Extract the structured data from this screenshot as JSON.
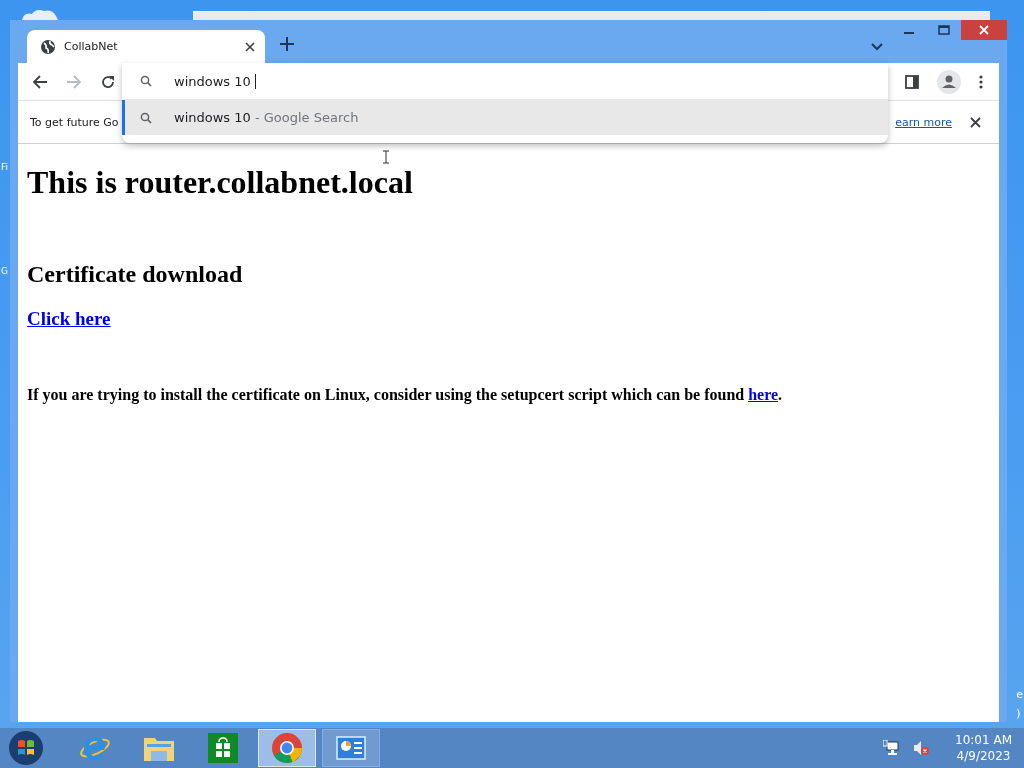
{
  "desktop": {
    "left_labels": [
      "Fi",
      "G"
    ],
    "right_labels": [
      "e",
      ")"
    ]
  },
  "browser": {
    "tabs": [
      {
        "title": "CollabNet",
        "selected": true
      }
    ],
    "omnibox": {
      "value": "windows 10",
      "suggestions": [
        {
          "text": "windows 10",
          "suffix": "- Google Search",
          "selected": true
        }
      ]
    },
    "infobar": {
      "text": "To get future Go",
      "link": "earn more"
    },
    "page": {
      "heading": "This is router.collabnet.local",
      "subheading": "Certificate download",
      "link": "Click here",
      "note": "If you are trying to install the certificate on Linux, consider using the setupcert script which can be found ",
      "note_link": "here",
      "note_end": "."
    }
  },
  "taskbar": {
    "apps": [
      {
        "kind": "ie",
        "running": false,
        "selected": false
      },
      {
        "kind": "folder",
        "running": false,
        "selected": false
      },
      {
        "kind": "store",
        "running": false,
        "selected": false
      },
      {
        "kind": "chrome",
        "running": true,
        "selected": true
      },
      {
        "kind": "panel",
        "running": true,
        "selected": false
      }
    ],
    "time": "10:01 AM",
    "date": "4/9/2023"
  }
}
